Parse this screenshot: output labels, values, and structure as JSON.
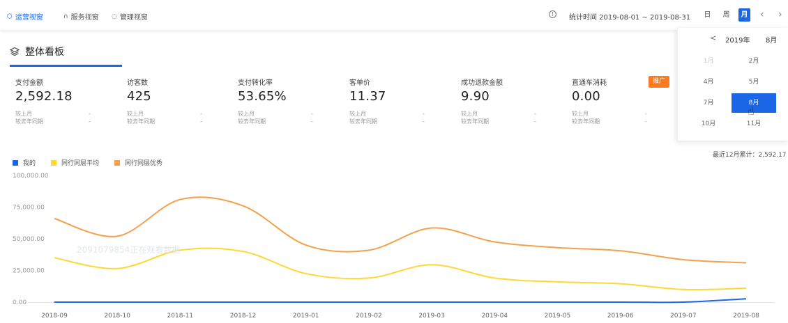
{
  "nav": {
    "tabs": [
      {
        "label": "运营视窗",
        "icon": "shield-icon",
        "active": true
      },
      {
        "label": "服务视窗",
        "icon": "headset-icon",
        "active": false
      },
      {
        "label": "管理视窗",
        "icon": "bulb-icon",
        "active": false
      }
    ],
    "stat_time": "统计时间 2019-08-01 ~ 2019-08-31",
    "periods": [
      "日",
      "周",
      "月"
    ],
    "active_period": "月",
    "accent": "#1a66e6"
  },
  "board": {
    "title": "整体看板",
    "icon": "layers-icon"
  },
  "metrics": [
    {
      "label": "支付金额",
      "value": "2,592.18",
      "cmp1": "较上月",
      "cmp2": "较去年同期",
      "dash": "-"
    },
    {
      "label": "访客数",
      "value": "425",
      "cmp1": "较上月",
      "cmp2": "较去年同期",
      "dash": "-"
    },
    {
      "label": "支付转化率",
      "value": "53.65%",
      "cmp1": "较上月",
      "cmp2": "较去年同期",
      "dash": "-"
    },
    {
      "label": "客单价",
      "value": "11.37",
      "cmp1": "较上月",
      "cmp2": "较去年同期",
      "dash": "-"
    },
    {
      "label": "成功退款金额",
      "value": "9.90",
      "cmp1": "较上月",
      "cmp2": "较去年同期",
      "dash": "-"
    },
    {
      "label": "直通车消耗",
      "value": "0.00",
      "cmp1": "较上月",
      "cmp2": "较去年同期",
      "dash": "-"
    }
  ],
  "promo_badge": "推广",
  "month_picker": {
    "prev": "<",
    "year": "2019年",
    "month": "8月",
    "months": [
      "1月",
      "2月",
      "4月",
      "5月",
      "7月",
      "8月",
      "10月",
      "11月"
    ],
    "disabled": [
      "1月"
    ],
    "selected": "8月"
  },
  "cumulative": "最近12月累计：2,592.17",
  "watermark": "2091079854正在观看数据",
  "chart_data": {
    "type": "line",
    "x": [
      "2018-09",
      "2018-10",
      "2018-11",
      "2018-12",
      "2019-01",
      "2019-02",
      "2019-03",
      "2019-04",
      "2019-05",
      "2019-06",
      "2019-07",
      "2019-08"
    ],
    "ylim": [
      0,
      100000
    ],
    "yticks": [
      "0.00",
      "25,000.00",
      "50,000.00",
      "75,000.00",
      "100,000.00"
    ],
    "series": [
      {
        "name": "我的",
        "color": "#1a66e6",
        "values": [
          0,
          0,
          0,
          0,
          0,
          0,
          0,
          0,
          0,
          0,
          0,
          2592.18
        ]
      },
      {
        "name": "同行同层平均",
        "color": "#fdd835",
        "values": [
          35000,
          26500,
          41000,
          40000,
          22500,
          19000,
          29500,
          19000,
          16000,
          14500,
          10000,
          11000
        ]
      },
      {
        "name": "同行同层优秀",
        "color": "#f5a04a",
        "values": [
          66000,
          52000,
          81000,
          76000,
          45000,
          41000,
          58500,
          47500,
          43000,
          40500,
          33500,
          31000
        ]
      }
    ],
    "grid": false,
    "legend": "top-left"
  }
}
